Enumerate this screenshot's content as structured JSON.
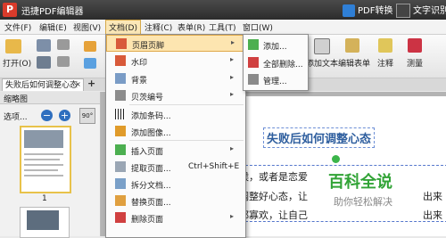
{
  "app": {
    "title": "迅捷PDF编辑器",
    "logo": "P",
    "pdf_convert": "PDF转换",
    "ocr": "文字识别"
  },
  "menubar": [
    "文件(F)",
    "编辑(E)",
    "视图(V)",
    "文档(D)",
    "注释(C)",
    "表单(R)",
    "工具(T)",
    "窗口(W)"
  ],
  "toolbar": {
    "open": "打开(O)",
    "add_text": "添加文本",
    "edit_form": "编辑表单",
    "annotate": "注释",
    "measure": "测量"
  },
  "tab": {
    "title": "失败后如何调整心态",
    "close": "×",
    "new": "+"
  },
  "thumbnails": {
    "title": "缩略图",
    "options": "选项...",
    "zoom_out": "−",
    "zoom_in": "+",
    "rotate": "90°",
    "page1": "1"
  },
  "doc_menu": {
    "items": [
      {
        "label": "页眉页脚",
        "arrow": "▸",
        "icon": "header-footer-icon"
      },
      {
        "label": "水印",
        "arrow": "▸",
        "icon": "watermark-icon"
      },
      {
        "label": "背景",
        "arrow": "▸",
        "icon": "background-icon"
      },
      {
        "label": "贝茨编号",
        "arrow": "▸",
        "icon": "bates-icon"
      },
      {
        "label": "添加条码...",
        "icon": "barcode-icon"
      },
      {
        "label": "添加图像...",
        "icon": "image-icon"
      },
      {
        "label": "插入页面",
        "arrow": "▸",
        "icon": "insert-page-icon"
      },
      {
        "label": "提取页面...",
        "shortcut": "Ctrl+Shift+E",
        "icon": "extract-page-icon"
      },
      {
        "label": "拆分文档...",
        "icon": "split-icon"
      },
      {
        "label": "替换页面...",
        "icon": "replace-page-icon"
      },
      {
        "label": "删除页面",
        "arrow": "▸",
        "icon": "delete-page-icon"
      }
    ]
  },
  "submenu": {
    "items": [
      "添加...",
      "全部删除...",
      "管理..."
    ]
  },
  "document": {
    "title": "失败后如何调整心态",
    "line1": "候，或者是恋爱",
    "line2": "调整好心态，让",
    "line3": "都寡欢，让自己",
    "right2": "出来",
    "right3": "出来",
    "watermark_main": "百科全说",
    "watermark_sub": "助你轻松解决"
  },
  "colors": {
    "accent": "#e0a94a",
    "watermark": "#31a336",
    "title": "#2e5e9e"
  }
}
